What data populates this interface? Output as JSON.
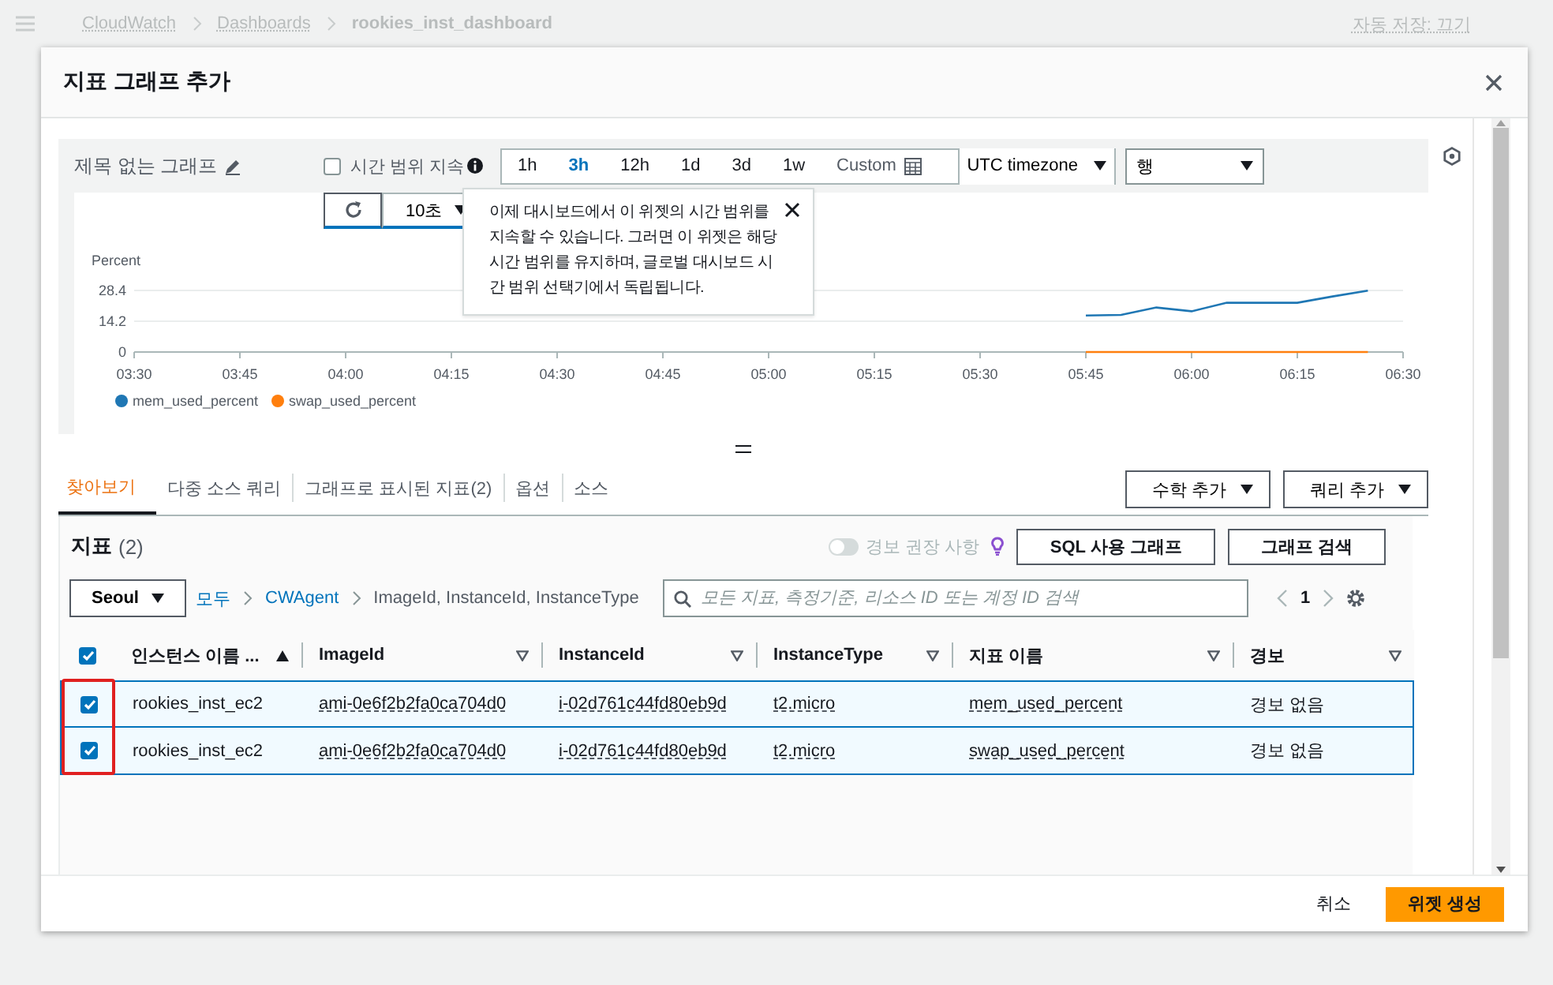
{
  "background": {
    "breadcrumb": [
      "CloudWatch",
      "Dashboards",
      "rookies_inst_dashboard"
    ],
    "autosave": "자동 저장: 끄기"
  },
  "dialog": {
    "title": "지표 그래프 추가",
    "graph": {
      "title": "제목 없는 그래프",
      "persist_time_range": {
        "label": "시간 범위 지속",
        "checked": false
      },
      "time_ranges": [
        {
          "label": "1h",
          "selected": false
        },
        {
          "label": "3h",
          "selected": true
        },
        {
          "label": "12h",
          "selected": false
        },
        {
          "label": "1d",
          "selected": false
        },
        {
          "label": "3d",
          "selected": false
        },
        {
          "label": "1w",
          "selected": false
        },
        {
          "label": "Custom",
          "selected": false
        }
      ],
      "timezone": "UTC timezone",
      "graph_type": "행",
      "refresh_interval": "10초",
      "tooltip": "이제 대시보드에서 이 위젯의 시간 범위를 지속할 수 있습니다. 그러면 이 위젯은 해당 시간 범위를 유지하며, 글로벌 대시보드 시간 범위 선택기에서 독립됩니다.",
      "chart_data": {
        "type": "line",
        "ylabel": "Percent",
        "ylim": [
          0,
          28.4
        ],
        "legend": "bottom",
        "categories": [
          "03:30",
          null,
          null,
          "03:45",
          null,
          null,
          "04:00",
          null,
          null,
          "04:15",
          null,
          null,
          "04:30",
          null,
          null,
          "04:45",
          null,
          null,
          "05:00",
          null,
          null,
          "05:15",
          null,
          null,
          "05:30",
          null,
          null,
          "05:45",
          null,
          null,
          "06:00",
          null,
          null,
          "06:15",
          null,
          null,
          "06:30"
        ],
        "yticks": [
          0,
          14.2,
          28.4
        ],
        "series": [
          {
            "name": "mem_used_percent",
            "color": "#1f77b4",
            "values": [
              null,
              null,
              null,
              null,
              null,
              null,
              null,
              null,
              null,
              null,
              null,
              null,
              null,
              null,
              null,
              null,
              null,
              null,
              null,
              null,
              null,
              null,
              null,
              null,
              null,
              null,
              null,
              16.8,
              17.1,
              20.5,
              18.8,
              22.7,
              22.7,
              22.7,
              25.6,
              28.3,
              null
            ]
          },
          {
            "name": "swap_used_percent",
            "color": "#ff7f0e",
            "values": [
              null,
              null,
              null,
              null,
              null,
              null,
              null,
              null,
              null,
              null,
              null,
              null,
              null,
              null,
              null,
              null,
              null,
              null,
              null,
              null,
              null,
              null,
              null,
              null,
              null,
              null,
              null,
              0,
              0,
              0,
              0,
              0,
              0,
              0,
              0,
              0,
              null
            ]
          }
        ]
      }
    },
    "tabs": [
      {
        "label": "찾아보기",
        "selected": true
      },
      {
        "label": "다중 소스 쿼리",
        "selected": false
      },
      {
        "label": "그래프로 표시된 지표(2)",
        "selected": false
      },
      {
        "label": "옵션",
        "selected": false
      },
      {
        "label": "소스",
        "selected": false
      }
    ],
    "math_button": "수학 추가",
    "query_button": "쿼리 추가",
    "metrics": {
      "title": "지표",
      "count": "(2)",
      "recommendations": {
        "label": "경보 권장 사항",
        "on": false
      },
      "sql_button": "SQL 사용 그래프",
      "search_button": "그래프 검색",
      "region": "Seoul",
      "path": [
        "모두",
        "CWAgent",
        "ImageId, InstanceId, InstanceType"
      ],
      "search_placeholder": "모든 지표, 측정기준, 리소스 ID 또는 계정 ID 검색",
      "page": "1",
      "table": {
        "select_all": true,
        "highlight_checkboxes": true,
        "columns": [
          {
            "label": "인스턴스 이름 ...",
            "sorted": true
          },
          {
            "label": "ImageId",
            "sorted": false
          },
          {
            "label": "InstanceId",
            "sorted": false
          },
          {
            "label": "InstanceType",
            "sorted": false
          },
          {
            "label": "지표 이름",
            "sorted": false
          },
          {
            "label": "경보",
            "sorted": false
          }
        ],
        "rows": [
          {
            "selected": true,
            "cells": [
              "rookies_inst_ec2",
              "ami-0e6f2b2fa0ca704d0",
              "i-02d761c44fd80eb9d",
              "t2.micro",
              "mem_used_percent",
              "경보 없음"
            ]
          },
          {
            "selected": true,
            "cells": [
              "rookies_inst_ec2",
              "ami-0e6f2b2fa0ca704d0",
              "i-02d761c44fd80eb9d",
              "t2.micro",
              "swap_used_percent",
              "경보 없음"
            ]
          }
        ]
      }
    },
    "footer": {
      "cancel": "취소",
      "create": "위젯 생성"
    }
  }
}
